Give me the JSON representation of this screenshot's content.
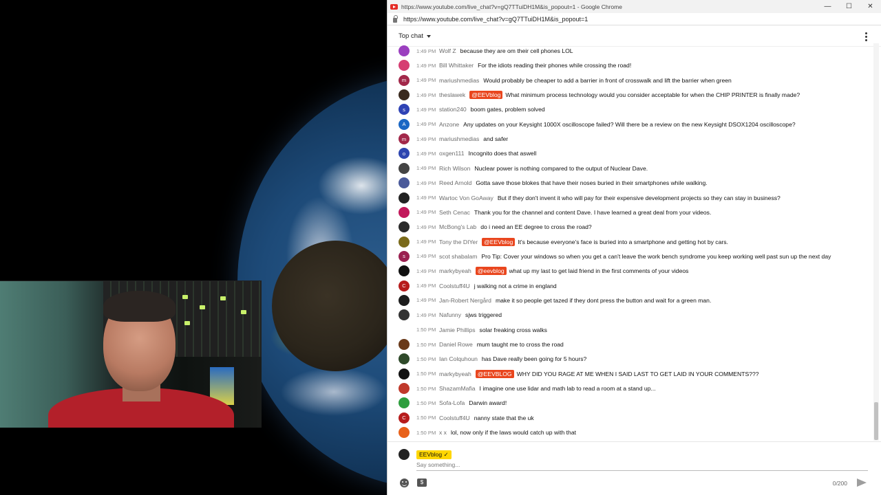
{
  "browser": {
    "window_title": "https://www.youtube.com/live_chat?v=gQ7TTuiDH1M&is_popout=1 - Google Chrome",
    "url": "https://www.youtube.com/live_chat?v=gQ7TTuiDH1M&is_popout=1",
    "minimize": "—",
    "maximize": "☐",
    "close": "✕"
  },
  "chat": {
    "mode_label": "Top chat",
    "messages": [
      {
        "time": "1:49 PM",
        "author": "Wolf Z",
        "mention": "",
        "text": "because they are om their cell phones LOL",
        "avatar": "",
        "color": "#9b3fbf"
      },
      {
        "time": "1:49 PM",
        "author": "Bill Whittaker",
        "mention": "",
        "text": "For the idiots reading their phones while crossing the road!",
        "avatar": "",
        "color": "#d63e72"
      },
      {
        "time": "1:49 PM",
        "author": "mariushmedias",
        "mention": "",
        "text": "Would probably be cheaper to add a barrier in front of crosswalk and lift the barrier when green",
        "avatar": "m",
        "color": "#a2284a"
      },
      {
        "time": "1:49 PM",
        "author": "theslawek",
        "mention": "@EEVblog",
        "text": "What minimum process technology would you consider acceptable for when the CHIP PRINTER is finally made?",
        "avatar": "",
        "color": "#3a2a1e"
      },
      {
        "time": "1:49 PM",
        "author": "station240",
        "mention": "",
        "text": "boom gates, problem solved",
        "avatar": "s",
        "color": "#2f43b5"
      },
      {
        "time": "1:49 PM",
        "author": "Anzone",
        "mention": "",
        "text": "Any updates on your Keysight 1000X oscilloscope failed? Will there be a review on the new Keysight DSOX1204 oscilloscope?",
        "avatar": "A",
        "color": "#1a67c4"
      },
      {
        "time": "1:49 PM",
        "author": "mariushmedias",
        "mention": "",
        "text": "and safer",
        "avatar": "m",
        "color": "#a2284a"
      },
      {
        "time": "1:49 PM",
        "author": "oxgen111",
        "mention": "",
        "text": "Incognito does that aswell",
        "avatar": "o",
        "color": "#2d45b0"
      },
      {
        "time": "1:49 PM",
        "author": "Rich Wilson",
        "mention": "",
        "text": "Nuclear power is nothing compared to the output of Nuclear Dave.",
        "avatar": "",
        "color": "#444444"
      },
      {
        "time": "1:49 PM",
        "author": "Reed Arnold",
        "mention": "",
        "text": "Gotta save those blokes that have their noses buried in their smartphones while walking.",
        "avatar": "",
        "color": "#4a5a9a"
      },
      {
        "time": "1:49 PM",
        "author": "Wartoc Von GoAway",
        "mention": "",
        "text": "But if they don't invent it who will pay for their expensive development projects so they can stay in business?",
        "avatar": "",
        "color": "#222222"
      },
      {
        "time": "1:49 PM",
        "author": "Seth Cenac",
        "mention": "",
        "text": "Thank you for the channel and content Dave. I have learned a great deal from your videos.",
        "avatar": "",
        "color": "#c2185b"
      },
      {
        "time": "1:49 PM",
        "author": "McBong's Lab",
        "mention": "",
        "text": "do i need an EE degree to cross the road?",
        "avatar": "",
        "color": "#2a2a2a"
      },
      {
        "time": "1:49 PM",
        "author": "Tony the DIYer",
        "mention": "@EEVblog",
        "text": "It's because everyone's face is buried into a smartphone and getting hot by cars.",
        "avatar": "",
        "color": "#7a6a1a"
      },
      {
        "time": "1:49 PM",
        "author": "scot shabalam",
        "mention": "",
        "text": "Pro Tip: Cover your windows so when you get a can't leave the work bench syndrome you keep working well past sun up the next day",
        "avatar": "s",
        "color": "#9a2050"
      },
      {
        "time": "1:49 PM",
        "author": "markybyeah",
        "mention": "@eevblog",
        "text": "what up my last to get laid friend in the first comments of your videos",
        "avatar": "",
        "color": "#111111"
      },
      {
        "time": "1:49 PM",
        "author": "Coolstuff4U",
        "mention": "",
        "text": "j walking not a crime in england",
        "avatar": "C",
        "color": "#b71c1c"
      },
      {
        "time": "1:49 PM",
        "author": "Jan-Robert Nergård",
        "mention": "",
        "text": "make it so people get tazed if they dont press the button and wait for a green man.",
        "avatar": "",
        "color": "#1d1d1d"
      },
      {
        "time": "1:49 PM",
        "author": "Nafunny",
        "mention": "",
        "text": "sjws triggered",
        "avatar": "",
        "color": "#333333"
      },
      {
        "time": "1:50 PM",
        "author": "Jamie Phillips",
        "mention": "",
        "text": "solar freaking cross walks",
        "avatar": "",
        "color": "#ffffff"
      },
      {
        "time": "1:50 PM",
        "author": "Daniel Rowe",
        "mention": "",
        "text": "mum taught me to cross the road",
        "avatar": "",
        "color": "#6a3a1a"
      },
      {
        "time": "1:50 PM",
        "author": "Ian Colquhoun",
        "mention": "",
        "text": "has Dave really been going for 5 hours?",
        "avatar": "",
        "color": "#2f4a2a"
      },
      {
        "time": "1:50 PM",
        "author": "markybyeah",
        "mention": "@EEVBLOG",
        "text": "WHY DID YOU RAGE AT ME WHEN I SAID LAST TO GET LAID IN YOUR COMMENTS???",
        "avatar": "",
        "color": "#111111"
      },
      {
        "time": "1:50 PM",
        "author": "ShazamMafia",
        "mention": "",
        "text": "I imagine one use lidar and math lab to read a room at a stand up...",
        "avatar": "",
        "color": "#c0392b"
      },
      {
        "time": "1:50 PM",
        "author": "Sofa-Lofa",
        "mention": "",
        "text": "Darwin award!",
        "avatar": "",
        "color": "#2e9e3e"
      },
      {
        "time": "1:50 PM",
        "author": "Coolstuff4U",
        "mention": "",
        "text": "nanny state that the uk",
        "avatar": "C",
        "color": "#b71c1c"
      },
      {
        "time": "1:50 PM",
        "author": "x x",
        "mention": "",
        "text": "lol, now only if the laws would catch up with that",
        "avatar": "",
        "color": "#e8611a"
      }
    ]
  },
  "composer": {
    "author": "EEVblog ✓",
    "placeholder": "Say something...",
    "counter": "0/200",
    "superchat_symbol": "$"
  }
}
